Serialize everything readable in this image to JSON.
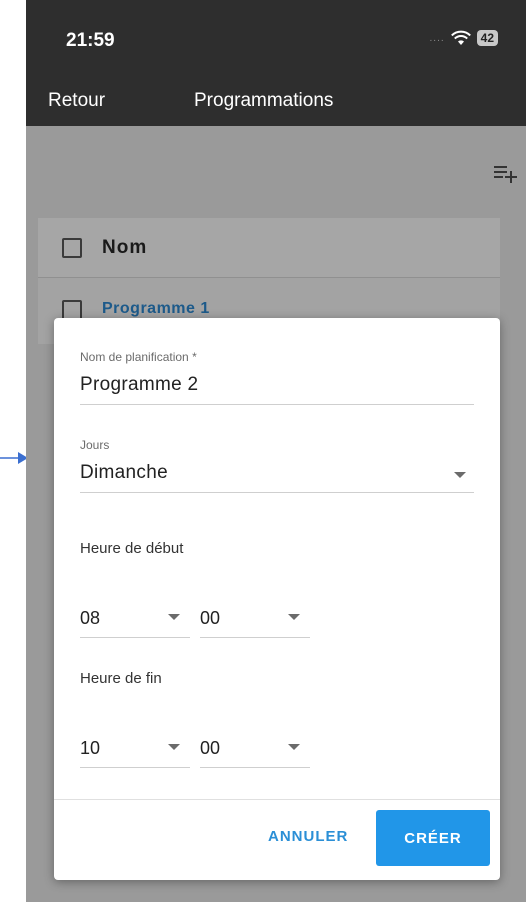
{
  "status_bar": {
    "time": "21:59",
    "battery": "42",
    "signal": "....",
    "wifi_icon": "wifi-icon"
  },
  "nav": {
    "back_label": "Retour",
    "title": "Programmations",
    "add_icon": "add-list-icon"
  },
  "list": {
    "header_label": "Nom",
    "items": [
      {
        "label": "Programme 1"
      }
    ]
  },
  "modal": {
    "name_field": {
      "label": "Nom de planification",
      "required_mark": "*",
      "value": "Programme 2"
    },
    "days_field": {
      "label": "Jours",
      "value": "Dimanche"
    },
    "start_time": {
      "label": "Heure de début",
      "hour": "08",
      "minute": "00"
    },
    "end_time": {
      "label": "Heure de fin",
      "hour": "10",
      "minute": "00"
    },
    "cancel_label": "ANNULER",
    "create_label": "CRÉER"
  },
  "colors": {
    "accent": "#2196e8",
    "link": "#2b8fd6",
    "header_bg": "#2e2e2e",
    "overlay": "#9a9a9a"
  }
}
